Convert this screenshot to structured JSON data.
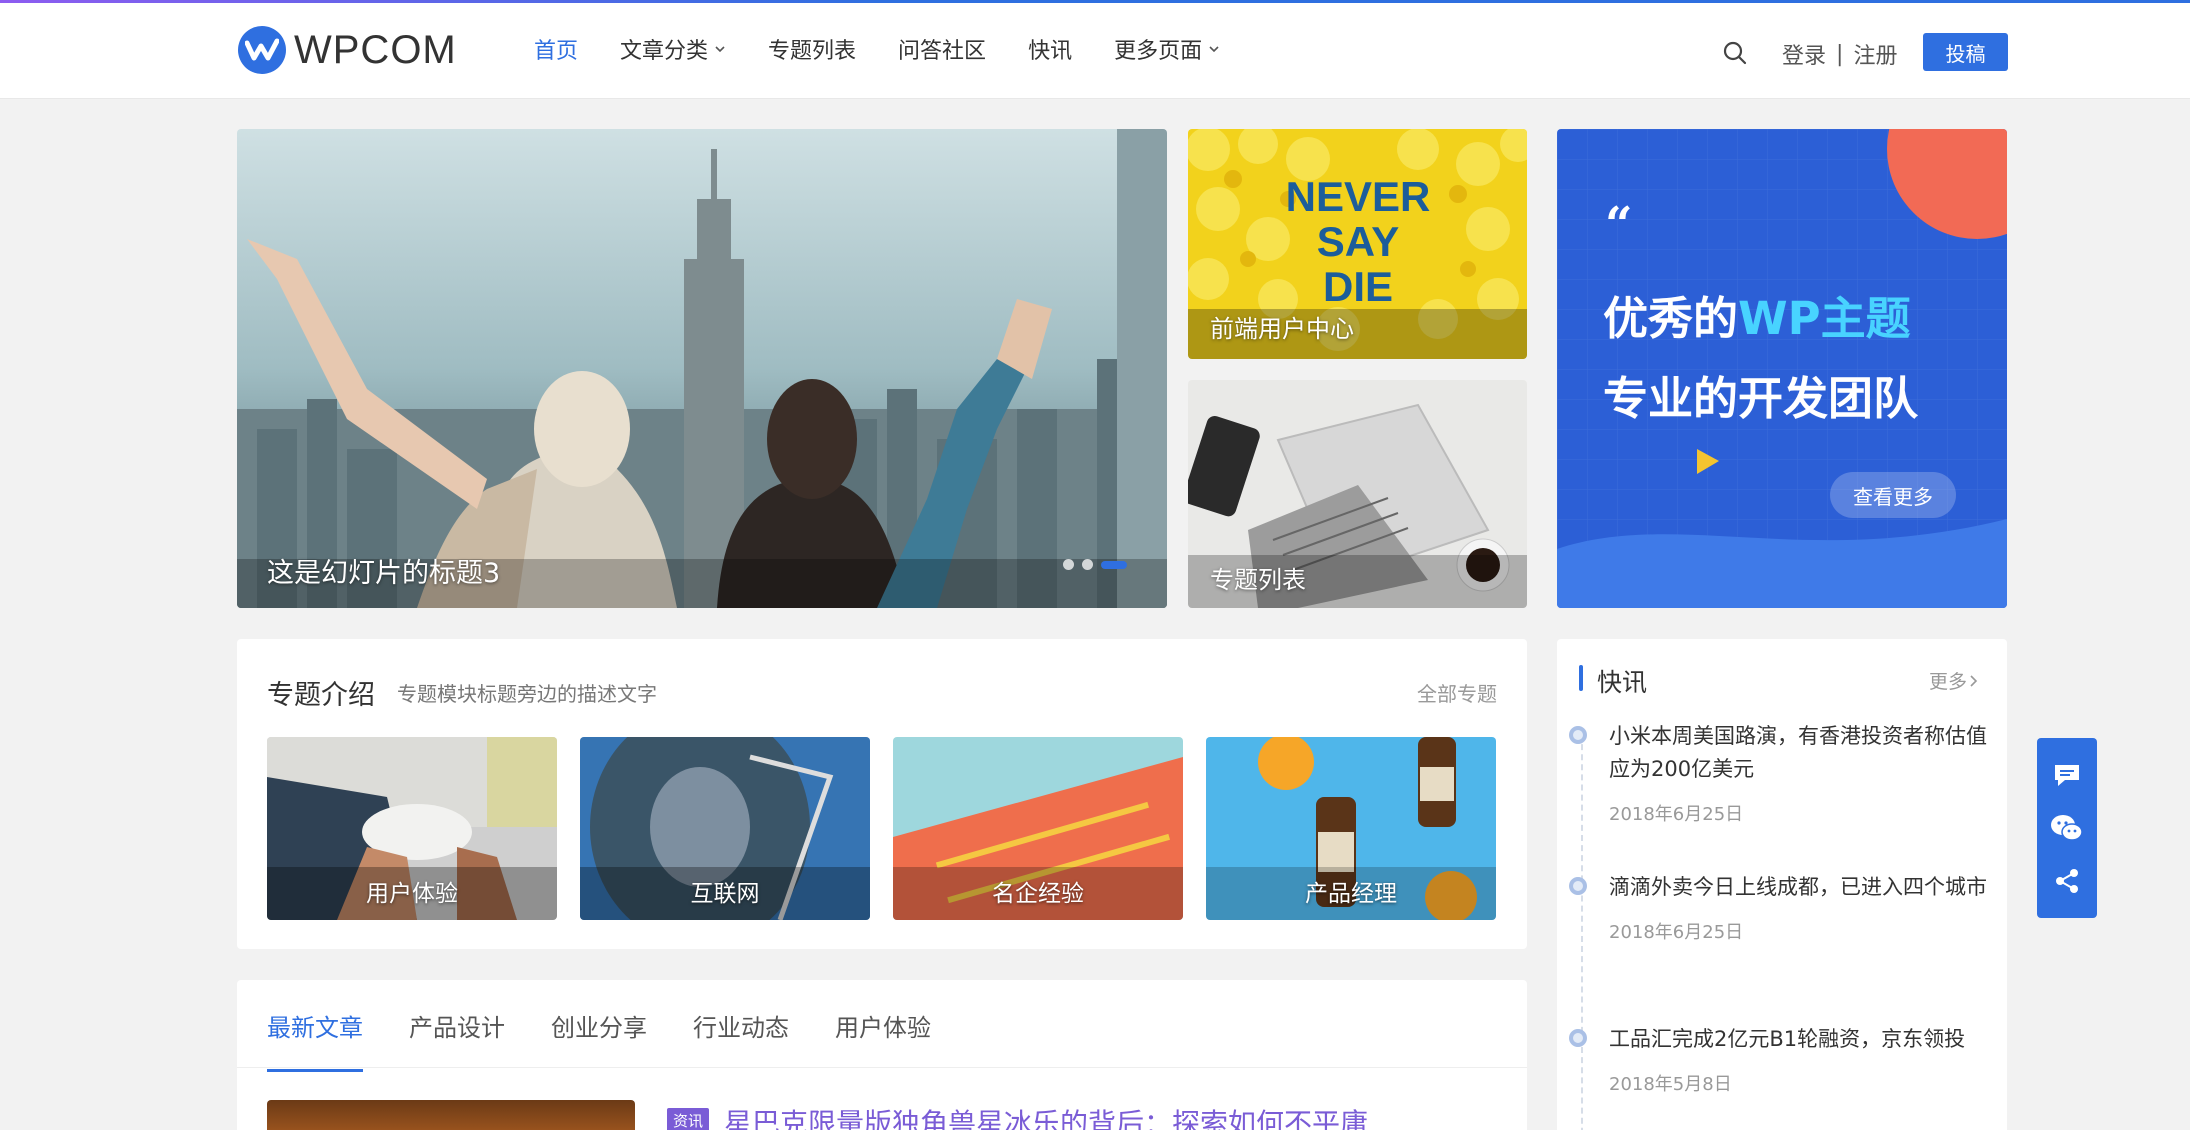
{
  "colors": {
    "accent": "#2f6fe0",
    "purple": "#7a5cd6"
  },
  "header": {
    "logo_text": "WPCOM",
    "nav": [
      {
        "label": "首页",
        "active": true,
        "dropdown": false
      },
      {
        "label": "文章分类",
        "active": false,
        "dropdown": true
      },
      {
        "label": "专题列表",
        "active": false,
        "dropdown": false
      },
      {
        "label": "问答社区",
        "active": false,
        "dropdown": false
      },
      {
        "label": "快讯",
        "active": false,
        "dropdown": false
      },
      {
        "label": "更多页面",
        "active": false,
        "dropdown": true
      }
    ],
    "login": "登录",
    "separator": "|",
    "register": "注册",
    "post_button": "投稿"
  },
  "hero": {
    "slide_title": "这是幻灯片的标题3",
    "dots_count": 3,
    "active_dot": 3,
    "side_cards": [
      {
        "label": "前端用户中心",
        "image_text": [
          "NEVER",
          "SAY",
          "DIE"
        ]
      },
      {
        "label": "专题列表"
      }
    ],
    "ad": {
      "quote_mark": "“",
      "line1_part1": "优秀的",
      "line1_part2": "WP主题",
      "line2": "专业的开发团队",
      "button": "查看更多"
    }
  },
  "topics": {
    "title": "专题介绍",
    "description": "专题模块标题旁边的描述文字",
    "all_link": "全部专题",
    "items": [
      {
        "label": "用户体验"
      },
      {
        "label": "互联网"
      },
      {
        "label": "名企经验"
      },
      {
        "label": "产品经理"
      }
    ]
  },
  "articles": {
    "tabs": [
      "最新文章",
      "产品设计",
      "创业分享",
      "行业动态",
      "用户体验"
    ],
    "first_tag": "资讯",
    "first_title": "星巴克限量版独角兽星冰乐的背后：探索如何不平庸"
  },
  "news": {
    "title": "快讯",
    "more": "更多",
    "items": [
      {
        "text": "小米本周美国路演，有香港投资者称估值应为200亿美元",
        "date": "2018年6月25日"
      },
      {
        "text": "滴滴外卖今日上线成都，已进入四个城市",
        "date": "2018年6月25日"
      },
      {
        "text": "工品汇完成2亿元B1轮融资，京东领投",
        "date": "2018年5月8日"
      }
    ]
  }
}
